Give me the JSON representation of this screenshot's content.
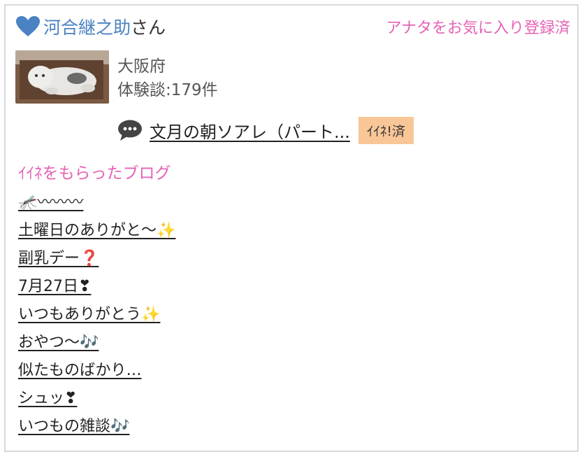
{
  "user": {
    "name": "河合継之助",
    "honorific": "さん",
    "favorite_status": "アナタをお気に入り登録済",
    "region": "大阪府",
    "experience_count": "体験談:179件"
  },
  "latest_post": {
    "title": "文月の朝ソアレ（パート...",
    "iine_badge": "ｲｲﾈ!済"
  },
  "section": {
    "title": "ｲｲﾈをもらったブログ"
  },
  "blogs": [
    {
      "title": "🦟〰〰〰"
    },
    {
      "title": "土曜日のありがと〜✨"
    },
    {
      "title": "副乳デー❓"
    },
    {
      "title": "7月27日❣"
    },
    {
      "title": "いつもありがとう✨"
    },
    {
      "title": "おやつ〜🎶"
    },
    {
      "title": "似たものばかり…"
    },
    {
      "title": "シュッ❣"
    },
    {
      "title": "いつもの雑談🎶"
    }
  ],
  "colors": {
    "accent_pink": "#e563b5",
    "link_blue": "#4a82c3",
    "badge_bg": "#f8c697"
  },
  "icons": {
    "heart": "heart-icon",
    "comment": "speech-bubble-icon",
    "avatar": "cat-figurine-avatar"
  }
}
